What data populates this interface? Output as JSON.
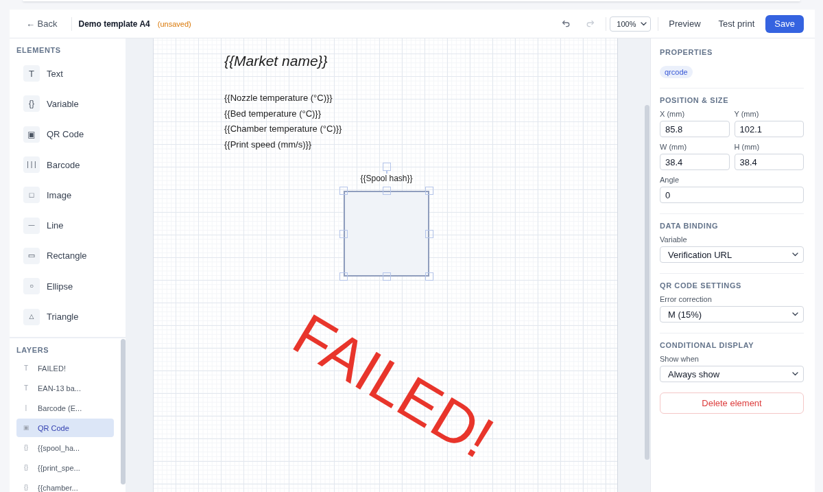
{
  "header": {
    "back": "← Back",
    "title": "Demo template A4",
    "status": "(unsaved)",
    "undo": {
      "disabled": false
    },
    "redo": {
      "disabled": true
    },
    "zoom": "100%",
    "actions": [
      {
        "label": "Preview",
        "kind": "plain"
      },
      {
        "label": "Test print",
        "kind": "plain"
      },
      {
        "label": "Save",
        "kind": "primary"
      }
    ]
  },
  "elements_panel": {
    "title": "ELEMENTS",
    "items": [
      {
        "kind": "text",
        "glyph": "T",
        "label": "Text"
      },
      {
        "kind": "variable",
        "glyph": "{}",
        "label": "Variable"
      },
      {
        "kind": "qrcode",
        "glyph": "▣",
        "label": "QR Code"
      },
      {
        "kind": "barcode",
        "glyph": "| | |",
        "label": "Barcode"
      },
      {
        "kind": "image",
        "glyph": "□",
        "label": "Image"
      },
      {
        "kind": "line",
        "glyph": "—",
        "label": "Line"
      },
      {
        "kind": "rectangle",
        "glyph": "▭",
        "label": "Rectangle"
      },
      {
        "kind": "ellipse",
        "glyph": "○",
        "label": "Ellipse"
      },
      {
        "kind": "triangle",
        "glyph": "△",
        "label": "Triangle"
      }
    ]
  },
  "layers_panel": {
    "title": "LAYERS",
    "items": [
      {
        "kind": "text",
        "glyph": "T",
        "label": "FAILED!",
        "selected": false
      },
      {
        "kind": "text",
        "glyph": "T",
        "label": "EAN-13 ba...",
        "selected": false
      },
      {
        "kind": "barcode",
        "glyph": "|",
        "label": "Barcode (E...",
        "selected": false
      },
      {
        "kind": "qrcode",
        "glyph": "▣",
        "label": "QR Code",
        "selected": true
      },
      {
        "kind": "variable",
        "glyph": "{}",
        "label": "{{spool_ha...",
        "selected": false
      },
      {
        "kind": "variable",
        "glyph": "{}",
        "label": "{{print_spe...",
        "selected": false
      },
      {
        "kind": "variable",
        "glyph": "{}",
        "label": "{{chamber...",
        "selected": false
      }
    ]
  },
  "canvas": {
    "title": "{{Market name}}",
    "fields": [
      "{{Nozzle temperature (°C)}}",
      "{{Bed temperature (°C)}}",
      "{{Chamber temperature (°C)}}",
      "{{Print speed (mm/s)}}"
    ],
    "qr_code": {
      "label": "{{Spool hash}}",
      "selected": true
    },
    "stamp": "FAILED!"
  },
  "properties": {
    "title": "PROPERTIES",
    "type_tag": "qrcode",
    "sections": [
      {
        "title": "POSITION & SIZE",
        "rows": [
          [
            {
              "kind": "input",
              "label": "X (mm)",
              "value": "85.8"
            },
            {
              "kind": "input",
              "label": "Y (mm)",
              "value": "102.1"
            }
          ],
          [
            {
              "kind": "input",
              "label": "W (mm)",
              "value": "38.4"
            },
            {
              "kind": "input",
              "label": "H (mm)",
              "value": "38.4"
            }
          ],
          [
            {
              "kind": "input",
              "label": "Angle",
              "value": "0"
            }
          ]
        ]
      },
      {
        "title": "DATA BINDING",
        "rows": [
          [
            {
              "kind": "select",
              "label": "Variable",
              "value": "Verification URL"
            }
          ]
        ]
      },
      {
        "title": "QR CODE SETTINGS",
        "rows": [
          [
            {
              "kind": "select",
              "label": "Error correction",
              "value": "M (15%)"
            }
          ]
        ]
      },
      {
        "title": "CONDITIONAL DISPLAY",
        "rows": [
          [
            {
              "kind": "select",
              "label": "Show when",
              "value": "Always show"
            }
          ]
        ]
      }
    ],
    "delete_button": "Delete element"
  }
}
